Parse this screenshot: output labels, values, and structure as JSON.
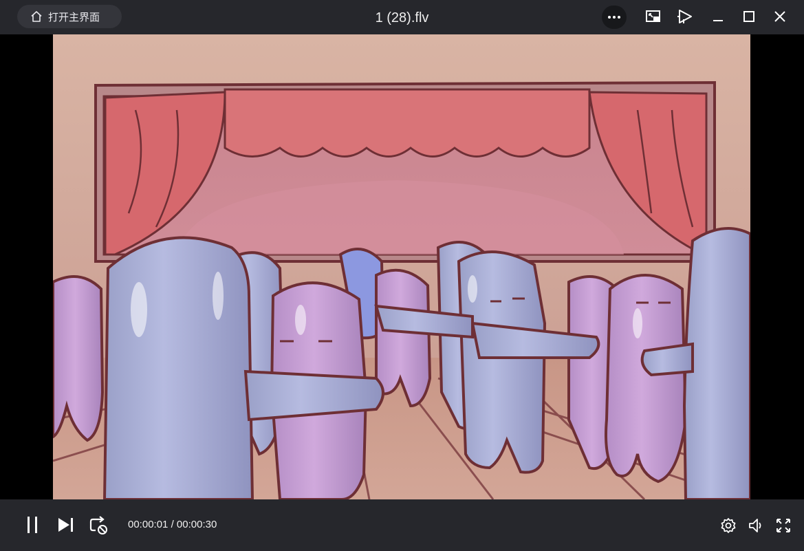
{
  "window": {
    "title": "1 (28).flv",
    "home_button_label": "打开主界面",
    "icons": {
      "home": "home-icon",
      "more": "more-icon",
      "pip": "picture-in-picture-icon",
      "cast": "cast-icon",
      "minimize": "minimize-icon",
      "maximize": "maximize-icon",
      "close": "close-icon"
    }
  },
  "player": {
    "current_time": "00:00:01",
    "separator": "/",
    "total_time": "00:00:30",
    "icons": {
      "pause": "pause-icon",
      "next": "next-icon",
      "loop": "loop-off-icon",
      "settings": "settings-icon",
      "volume": "volume-icon",
      "fullscreen": "fullscreen-icon"
    }
  },
  "colors": {
    "titlebar_bg": "#26272c",
    "control_bg": "#26272c",
    "accent": "#ffffff"
  }
}
